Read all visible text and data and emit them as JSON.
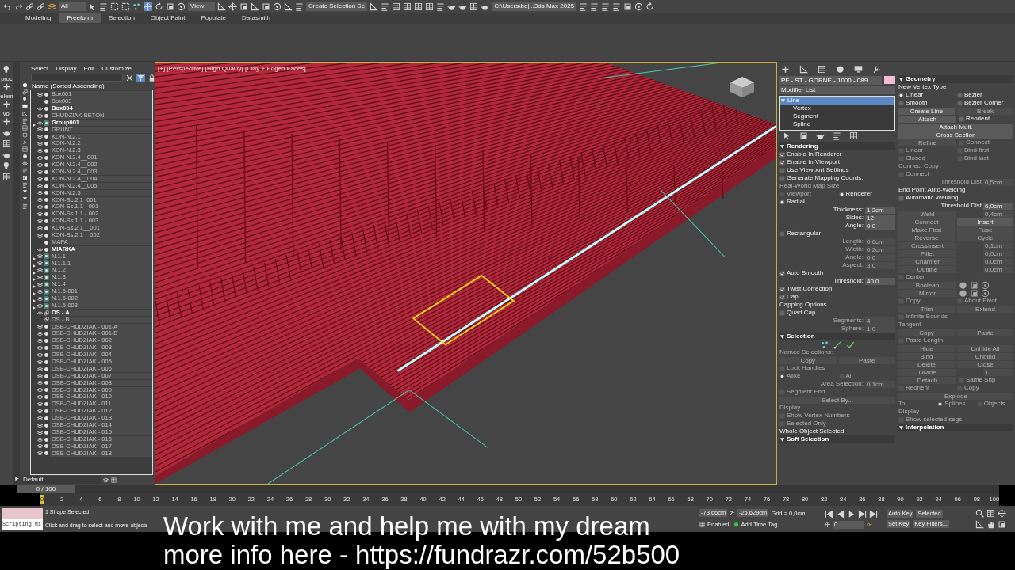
{
  "toolbar": {
    "selection_filter": "All",
    "reference_coord": "View",
    "named_selection": "Create Selection Se",
    "project_path": "C:\\Users\\bej...3ds Max 2025"
  },
  "ribbon_tabs": [
    {
      "label": "Modeling",
      "selected": false
    },
    {
      "label": "Freeform",
      "selected": true
    },
    {
      "label": "Selection",
      "selected": false
    },
    {
      "label": "Object Paint",
      "selected": false
    },
    {
      "label": "Populate",
      "selected": false
    },
    {
      "label": "Datasmith",
      "selected": false
    }
  ],
  "left_tool_labels": [
    "proc",
    "elem",
    "vol"
  ],
  "scene_explorer": {
    "menus": [
      "Select",
      "Display",
      "Edit",
      "Customize"
    ],
    "column_header": "Name (Sorted Ascending)",
    "layer": "Default",
    "items": [
      {
        "name": "Box001",
        "visible": false,
        "hidden": false,
        "kind": "object",
        "expandable": false
      },
      {
        "name": "Box003",
        "visible": false,
        "hidden": true,
        "kind": "object",
        "expandable": false
      },
      {
        "name": "Box004",
        "visible": true,
        "hidden": false,
        "kind": "object",
        "expandable": false
      },
      {
        "name": "CHUDZIAK-BETON",
        "visible": false,
        "hidden": false,
        "kind": "object",
        "expandable": false
      },
      {
        "name": "Group001",
        "visible": true,
        "hidden": false,
        "kind": "group",
        "expandable": true
      },
      {
        "name": "GRUNT",
        "visible": false,
        "hidden": false,
        "kind": "object",
        "expandable": false
      },
      {
        "name": "KON-N.2.1",
        "visible": false,
        "hidden": false,
        "kind": "object",
        "expandable": false
      },
      {
        "name": "KON-N.2.2",
        "visible": false,
        "hidden": false,
        "kind": "object",
        "expandable": false
      },
      {
        "name": "KON-N.2.3",
        "visible": false,
        "hidden": false,
        "kind": "object",
        "expandable": false
      },
      {
        "name": "KON-N.2.4__001",
        "visible": false,
        "hidden": false,
        "kind": "object",
        "expandable": false
      },
      {
        "name": "KON-N.2.4__002",
        "visible": false,
        "hidden": false,
        "kind": "object",
        "expandable": false
      },
      {
        "name": "KON-N.2.4__003",
        "visible": false,
        "hidden": false,
        "kind": "object",
        "expandable": false
      },
      {
        "name": "KON-N.2.4__004",
        "visible": false,
        "hidden": false,
        "kind": "object",
        "expandable": false
      },
      {
        "name": "KON-N.2.4__005",
        "visible": false,
        "hidden": false,
        "kind": "object",
        "expandable": false
      },
      {
        "name": "KON-N.2.5",
        "visible": false,
        "hidden": false,
        "kind": "object",
        "expandable": false
      },
      {
        "name": "KON-Sc.2.1_001",
        "visible": false,
        "hidden": false,
        "kind": "object",
        "expandable": false
      },
      {
        "name": "KON-Ss.1.1 - 001",
        "visible": false,
        "hidden": false,
        "kind": "object",
        "expandable": false
      },
      {
        "name": "KON-Ss.1.1 - 002",
        "visible": false,
        "hidden": false,
        "kind": "object",
        "expandable": false
      },
      {
        "name": "KON-Ss.1.1 - 003",
        "visible": false,
        "hidden": false,
        "kind": "object",
        "expandable": false
      },
      {
        "name": "KON-Ss.2.1__001",
        "visible": false,
        "hidden": false,
        "kind": "object",
        "expandable": false
      },
      {
        "name": "KON-Ss.2.1__002",
        "visible": false,
        "hidden": false,
        "kind": "object",
        "expandable": false
      },
      {
        "name": "MAPA",
        "visible": false,
        "hidden": true,
        "kind": "object",
        "expandable": false
      },
      {
        "name": "MIARKA",
        "visible": true,
        "hidden": false,
        "kind": "object",
        "expandable": false
      },
      {
        "name": "N.1.1",
        "visible": false,
        "hidden": false,
        "kind": "group",
        "expandable": true
      },
      {
        "name": "N.1.1.1",
        "visible": false,
        "hidden": false,
        "kind": "group",
        "expandable": true
      },
      {
        "name": "N.1.2",
        "visible": false,
        "hidden": false,
        "kind": "group",
        "expandable": true
      },
      {
        "name": "N.1.3",
        "visible": false,
        "hidden": false,
        "kind": "group",
        "expandable": true
      },
      {
        "name": "N.1.4",
        "visible": false,
        "hidden": false,
        "kind": "group",
        "expandable": true
      },
      {
        "name": "N.1.5-001",
        "visible": false,
        "hidden": false,
        "kind": "group",
        "expandable": true
      },
      {
        "name": "N.1.5-002",
        "visible": false,
        "hidden": false,
        "kind": "group",
        "expandable": true
      },
      {
        "name": "N.1.5-003",
        "visible": false,
        "hidden": false,
        "kind": "group",
        "expandable": true
      },
      {
        "name": "OS - A",
        "visible": true,
        "hidden": false,
        "kind": "shape",
        "expandable": false
      },
      {
        "name": "OS - B",
        "visible": false,
        "hidden": true,
        "kind": "shape",
        "expandable": false
      },
      {
        "name": "OSB-CHUDZIAK - 001-A",
        "visible": false,
        "hidden": false,
        "kind": "object",
        "expandable": false
      },
      {
        "name": "OSB-CHUDZIAK - 001-B",
        "visible": false,
        "hidden": false,
        "kind": "object",
        "expandable": false
      },
      {
        "name": "OSB-CHUDZIAK - 002",
        "visible": false,
        "hidden": false,
        "kind": "object",
        "expandable": false
      },
      {
        "name": "OSB-CHUDZIAK - 003",
        "visible": false,
        "hidden": false,
        "kind": "object",
        "expandable": false
      },
      {
        "name": "OSB-CHUDZIAK - 004",
        "visible": false,
        "hidden": false,
        "kind": "object",
        "expandable": false
      },
      {
        "name": "OSB-CHUDZIAK - 005",
        "visible": false,
        "hidden": false,
        "kind": "object",
        "expandable": false
      },
      {
        "name": "OSB-CHUDZIAK - 006",
        "visible": false,
        "hidden": false,
        "kind": "object",
        "expandable": false
      },
      {
        "name": "OSB-CHUDZIAK - 007",
        "visible": false,
        "hidden": false,
        "kind": "object",
        "expandable": false
      },
      {
        "name": "OSB-CHUDZIAK - 008",
        "visible": false,
        "hidden": false,
        "kind": "object",
        "expandable": false
      },
      {
        "name": "OSB-CHUDZIAK - 009",
        "visible": false,
        "hidden": false,
        "kind": "object",
        "expandable": false
      },
      {
        "name": "OSB-CHUDZIAK - 010",
        "visible": false,
        "hidden": false,
        "kind": "object",
        "expandable": false
      },
      {
        "name": "OSB-CHUDZIAK - 011",
        "visible": false,
        "hidden": false,
        "kind": "object",
        "expandable": false
      },
      {
        "name": "OSB-CHUDZIAK - 012",
        "visible": false,
        "hidden": false,
        "kind": "object",
        "expandable": false
      },
      {
        "name": "OSB-CHUDZIAK - 013",
        "visible": false,
        "hidden": false,
        "kind": "object",
        "expandable": false
      },
      {
        "name": "OSB-CHUDZIAK - 014",
        "visible": false,
        "hidden": false,
        "kind": "object",
        "expandable": false
      },
      {
        "name": "OSB-CHUDZIAK - 015",
        "visible": false,
        "hidden": false,
        "kind": "object",
        "expandable": false
      },
      {
        "name": "OSB-CHUDZIAK - 016",
        "visible": false,
        "hidden": false,
        "kind": "object",
        "expandable": false
      },
      {
        "name": "OSB-CHUDZIAK - 017",
        "visible": false,
        "hidden": false,
        "kind": "object",
        "expandable": false
      },
      {
        "name": "OSB-CHUDZIAK - 018",
        "visible": false,
        "hidden": false,
        "kind": "object",
        "expandable": false
      }
    ]
  },
  "viewport": {
    "label": "[+] [Perspective] [High Quality] [Clay + Edged Faces]"
  },
  "command_panel": {
    "object_name": "PF - ST - GORNE - 1000 - 089",
    "modifier_list": "Modifier List",
    "stack": [
      {
        "label": "Line",
        "selected": true,
        "expanded": true,
        "children": [
          {
            "label": "Vertex",
            "selected": false
          },
          {
            "label": "Segment",
            "selected": false
          },
          {
            "label": "Spline",
            "selected": false
          }
        ]
      }
    ],
    "left_rows": [
      [
        {
          "kind": "heading",
          "label": "Rendering"
        }
      ],
      [
        {
          "kind": "check",
          "label": "Enable In Renderer",
          "checked": true,
          "disabled": false
        }
      ],
      [
        {
          "kind": "check",
          "label": "Enable In Viewport",
          "checked": true,
          "disabled": false
        }
      ],
      [
        {
          "kind": "check",
          "label": "Use Viewport Settings",
          "checked": false,
          "disabled": false
        }
      ],
      [
        {
          "kind": "check",
          "label": "Generate Mapping Coords.",
          "checked": false,
          "disabled": false
        }
      ],
      [
        {
          "kind": "label",
          "label": "Real-World Map Size",
          "disabled": true
        }
      ],
      [
        {
          "kind": "radio",
          "label": "Viewport",
          "selected": false,
          "disabled": true
        },
        {
          "kind": "radio",
          "label": "Renderer",
          "selected": true,
          "disabled": false
        }
      ],
      [
        {
          "kind": "radio",
          "label": "Radial",
          "selected": true,
          "disabled": false
        }
      ],
      [
        {
          "kind": "spinner",
          "label": "Thickness:",
          "value": "1,2cm",
          "disabled": false
        }
      ],
      [
        {
          "kind": "spinner",
          "label": "Sides:",
          "value": "12",
          "disabled": false
        }
      ],
      [
        {
          "kind": "spinner",
          "label": "Angle:",
          "value": "0,0",
          "disabled": false
        }
      ],
      [
        {
          "kind": "radio",
          "label": "Rectangular",
          "selected": false,
          "disabled": false
        }
      ],
      [
        {
          "kind": "spinner",
          "label": "Length:",
          "value": "0,6cm",
          "disabled": true
        }
      ],
      [
        {
          "kind": "spinner",
          "label": "Width:",
          "value": "0,2cm",
          "disabled": true
        }
      ],
      [
        {
          "kind": "spinner",
          "label": "Angle:",
          "value": "0,0",
          "disabled": true
        }
      ],
      [
        {
          "kind": "spinner",
          "label": "Aspect:",
          "value": "3,0",
          "disabled": true
        }
      ],
      [
        {
          "kind": "check",
          "label": "Auto Smooth",
          "checked": true,
          "disabled": false
        }
      ],
      [
        {
          "kind": "spinner",
          "label": "Threshold:",
          "value": "40,0",
          "disabled": false
        }
      ],
      [
        {
          "kind": "check",
          "label": "Twist Correction",
          "checked": true,
          "disabled": false
        }
      ],
      [
        {
          "kind": "check",
          "label": "Cap",
          "checked": true,
          "disabled": false
        }
      ],
      [
        {
          "kind": "label",
          "label": "Capping Options",
          "disabled": false
        }
      ],
      [
        {
          "kind": "check",
          "label": "Quad Cap",
          "checked": false,
          "disabled": false
        }
      ],
      [
        {
          "kind": "spinner",
          "label": "Segments:",
          "value": "4",
          "disabled": true
        }
      ],
      [
        {
          "kind": "spinner",
          "label": "Sphere:",
          "value": "1,0",
          "disabled": true
        }
      ],
      [
        {
          "kind": "heading",
          "label": "Selection"
        }
      ],
      [
        {
          "kind": "level_icons"
        }
      ],
      [
        {
          "kind": "label",
          "label": "Named Selections:",
          "disabled": true
        }
      ],
      [
        {
          "kind": "button",
          "label": "Copy",
          "disabled": true
        },
        {
          "kind": "button",
          "label": "Paste",
          "disabled": true
        }
      ],
      [
        {
          "kind": "check",
          "label": "Lock Handles",
          "checked": false,
          "disabled": true
        }
      ],
      [
        {
          "kind": "radio",
          "label": "Alike",
          "selected": true,
          "disabled": true
        },
        {
          "kind": "radio",
          "label": "All",
          "selected": false,
          "disabled": true
        }
      ],
      [
        {
          "kind": "spinner",
          "label": "Area Selection:",
          "value": "0,1cm",
          "disabled": true
        }
      ],
      [
        {
          "kind": "check",
          "label": "Segment End",
          "checked": false,
          "disabled": true
        }
      ],
      [
        {
          "kind": "button",
          "label": "Select By...",
          "disabled": true
        }
      ],
      [
        {
          "kind": "label",
          "label": "Display",
          "disabled": true
        }
      ],
      [
        {
          "kind": "check",
          "label": "Show Vertex Numbers",
          "checked": false,
          "disabled": true
        }
      ],
      [
        {
          "kind": "check",
          "label": "Selected Only",
          "checked": false,
          "disabled": true
        }
      ],
      [
        {
          "kind": "label",
          "label": "Whole Object Selected",
          "disabled": false
        }
      ],
      [
        {
          "kind": "heading",
          "label": "Soft Selection"
        }
      ]
    ],
    "right_rows": [
      [
        {
          "kind": "heading",
          "label": "Geometry"
        }
      ],
      [
        {
          "kind": "label",
          "label": "New Vertex Type",
          "disabled": false
        }
      ],
      [
        {
          "kind": "radio",
          "label": "Linear",
          "selected": true,
          "disabled": false
        },
        {
          "kind": "radio",
          "label": "Bezier",
          "selected": false,
          "disabled": false
        }
      ],
      [
        {
          "kind": "radio",
          "label": "Smooth",
          "selected": false,
          "disabled": false
        },
        {
          "kind": "radio",
          "label": "Bezier Corner",
          "selected": false,
          "disabled": false
        }
      ],
      [
        {
          "kind": "button",
          "label": "Create Line",
          "disabled": false
        },
        {
          "kind": "button",
          "label": "Break",
          "disabled": true
        }
      ],
      [
        {
          "kind": "button",
          "label": "Attach",
          "disabled": false
        },
        {
          "kind": "check",
          "label": "Reorient",
          "checked": false,
          "disabled": false
        }
      ],
      [
        {
          "kind": "button",
          "label": "Attach Mult.",
          "disabled": false
        }
      ],
      [
        {
          "kind": "button",
          "label": "Cross Section",
          "disabled": false
        }
      ],
      [
        {
          "kind": "button",
          "label": "Refine",
          "disabled": true
        },
        {
          "kind": "check",
          "label": "Connect",
          "checked": false,
          "disabled": true
        }
      ],
      [
        {
          "kind": "check",
          "label": "Linear",
          "checked": false,
          "disabled": true
        },
        {
          "kind": "check",
          "label": "Bind first",
          "checked": false,
          "disabled": true
        }
      ],
      [
        {
          "kind": "check",
          "label": "Closed",
          "checked": false,
          "disabled": true
        },
        {
          "kind": "check",
          "label": "Bind last",
          "checked": false,
          "disabled": true
        }
      ],
      [
        {
          "kind": "label",
          "label": "Connect Copy",
          "disabled": true
        }
      ],
      [
        {
          "kind": "check",
          "label": "Connect",
          "checked": false,
          "disabled": true
        }
      ],
      [
        {
          "kind": "spinner",
          "label": "Threshold Dist",
          "value": "0,5cm",
          "disabled": true
        }
      ],
      [
        {
          "kind": "label",
          "label": "End Point Auto-Welding",
          "disabled": false
        }
      ],
      [
        {
          "kind": "check",
          "label": "Automatic Welding",
          "checked": false,
          "disabled": false
        }
      ],
      [
        {
          "kind": "spinner",
          "label": "Threshold Dist",
          "value": "6,0cm",
          "disabled": false
        }
      ],
      [
        {
          "kind": "button",
          "label": "Weld",
          "disabled": true
        },
        {
          "kind": "spinner",
          "value": "0,4cm",
          "disabled": true
        }
      ],
      [
        {
          "kind": "button",
          "label": "Connect",
          "disabled": true
        },
        {
          "kind": "button",
          "label": "Insert",
          "disabled": false
        }
      ],
      [
        {
          "kind": "button",
          "label": "Make First",
          "disabled": true
        },
        {
          "kind": "button",
          "label": "Fuse",
          "disabled": true
        }
      ],
      [
        {
          "kind": "button",
          "label": "Reverse",
          "disabled": true
        },
        {
          "kind": "button",
          "label": "Cycle",
          "disabled": true
        }
      ],
      [
        {
          "kind": "button",
          "label": "CrossInsert",
          "disabled": true
        },
        {
          "kind": "spinner",
          "value": "0,1cm",
          "disabled": true
        }
      ],
      [
        {
          "kind": "button",
          "label": "Fillet",
          "disabled": true
        },
        {
          "kind": "spinner",
          "value": "0,0cm",
          "disabled": true
        }
      ],
      [
        {
          "kind": "button",
          "label": "Chamfer",
          "disabled": true
        },
        {
          "kind": "spinner",
          "value": "0,0cm",
          "disabled": true
        }
      ],
      [
        {
          "kind": "button",
          "label": "Outline",
          "disabled": true
        },
        {
          "kind": "spinner",
          "value": "0,0cm",
          "disabled": true
        }
      ],
      [
        {
          "kind": "check",
          "label": "Center",
          "checked": false,
          "disabled": true
        }
      ],
      [
        {
          "kind": "button",
          "label": "Boolean",
          "disabled": true
        },
        {
          "kind": "icon_group"
        }
      ],
      [
        {
          "kind": "button",
          "label": "Mirror",
          "disabled": true
        },
        {
          "kind": "icon_group"
        }
      ],
      [
        {
          "kind": "check",
          "label": "Copy",
          "checked": false,
          "disabled": true
        },
        {
          "kind": "check",
          "label": "About Pivot",
          "checked": false,
          "disabled": true
        }
      ],
      [
        {
          "kind": "button",
          "label": "Trim",
          "disabled": true
        },
        {
          "kind": "button",
          "label": "Extend",
          "disabled": true
        }
      ],
      [
        {
          "kind": "check",
          "label": "Infinite Bounds",
          "checked": false,
          "disabled": true
        }
      ],
      [
        {
          "kind": "label",
          "label": "Tangent",
          "disabled": true
        }
      ],
      [
        {
          "kind": "button",
          "label": "Copy",
          "disabled": true
        },
        {
          "kind": "button",
          "label": "Paste",
          "disabled": true
        }
      ],
      [
        {
          "kind": "check",
          "label": "Paste Length",
          "checked": false,
          "disabled": true
        }
      ],
      [
        {
          "kind": "button",
          "label": "Hide",
          "disabled": true
        },
        {
          "kind": "button",
          "label": "Unhide All",
          "disabled": true
        }
      ],
      [
        {
          "kind": "button",
          "label": "Bind",
          "disabled": true
        },
        {
          "kind": "button",
          "label": "Unbind",
          "disabled": true
        }
      ],
      [
        {
          "kind": "button",
          "label": "Delete",
          "disabled": true
        },
        {
          "kind": "button",
          "label": "Close",
          "disabled": true
        }
      ],
      [
        {
          "kind": "button",
          "label": "Divide",
          "disabled": true
        },
        {
          "kind": "spinner",
          "value": "1",
          "disabled": true
        }
      ],
      [
        {
          "kind": "button",
          "label": "Detach",
          "disabled": true
        },
        {
          "kind": "check",
          "label": "Same Shp",
          "checked": false,
          "disabled": true
        }
      ],
      [
        {
          "kind": "check",
          "label": "Reorient",
          "checked": false,
          "disabled": true
        },
        {
          "kind": "check",
          "label": "Copy",
          "checked": false,
          "disabled": true
        }
      ],
      [
        {
          "kind": "button",
          "label": "Explode",
          "disabled": true
        }
      ],
      [
        {
          "kind": "label",
          "label": "To:",
          "disabled": true
        },
        {
          "kind": "radio",
          "label": "Splines",
          "selected": true,
          "disabled": true
        },
        {
          "kind": "radio",
          "label": "Objects",
          "selected": false,
          "disabled": true
        }
      ],
      [
        {
          "kind": "label",
          "label": "Display",
          "disabled": true
        }
      ],
      [
        {
          "kind": "check",
          "label": "Show selected segs",
          "checked": false,
          "disabled": true
        }
      ],
      [
        {
          "kind": "heading",
          "label": "Interpolation"
        }
      ]
    ]
  },
  "timeline": {
    "frame_range": "0 / 100",
    "level": 0,
    "current_frame_label": "0",
    "ticks": [
      "2",
      "4",
      "6",
      "8",
      "10",
      "12",
      "14",
      "16",
      "18",
      "20",
      "22",
      "24",
      "26",
      "28",
      "30",
      "32",
      "34",
      "36",
      "38",
      "40",
      "42",
      "44",
      "46",
      "48",
      "50",
      "52",
      "54",
      "56",
      "58",
      "60",
      "62",
      "64",
      "66",
      "68",
      "70",
      "72",
      "74",
      "76",
      "78",
      "80",
      "82",
      "84",
      "86",
      "88",
      "90",
      "92",
      "94",
      "96",
      "98",
      "100"
    ]
  },
  "status_bar": {
    "listener": "Scripting Mi",
    "selection_info": "1 Shape Selected",
    "prompt": "Click and drag to select and move objects",
    "x_coord": "-73,66cm",
    "z_label": "Z:",
    "z_coord": "-25,629cm",
    "grid": "Grid = 0,0cm",
    "enabled_label": "Enabled:",
    "time_tag": "Add Time Tag",
    "auto_key": "Auto Key",
    "key_mode": "Selected",
    "set_key": "Set Key",
    "key_filters": "Key Filters...",
    "current_frame": "0"
  },
  "caption": [
    "Work with me and help me with my dream",
    "more info here - https://fundrazr.com/52b500"
  ]
}
